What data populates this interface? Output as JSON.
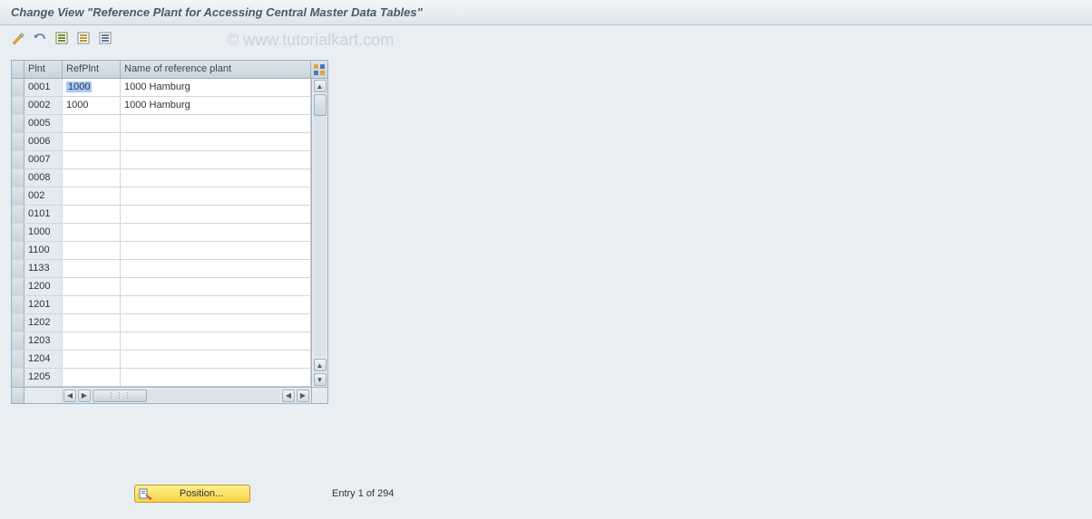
{
  "title": "Change View \"Reference Plant for Accessing Central Master Data Tables\"",
  "watermark": "© www.tutorialkart.com",
  "columns": {
    "plnt": "Plnt",
    "refplnt": "RefPlnt",
    "name": "Name of reference plant"
  },
  "rows": [
    {
      "plnt": "0001",
      "refplnt": "1000",
      "name": "1000 Hamburg",
      "highlight": true
    },
    {
      "plnt": "0002",
      "refplnt": "1000",
      "name": "1000 Hamburg"
    },
    {
      "plnt": "0005",
      "refplnt": "",
      "name": ""
    },
    {
      "plnt": "0006",
      "refplnt": "",
      "name": ""
    },
    {
      "plnt": "0007",
      "refplnt": "",
      "name": ""
    },
    {
      "plnt": "0008",
      "refplnt": "",
      "name": ""
    },
    {
      "plnt": "002",
      "refplnt": "",
      "name": ""
    },
    {
      "plnt": "0101",
      "refplnt": "",
      "name": ""
    },
    {
      "plnt": "1000",
      "refplnt": "",
      "name": ""
    },
    {
      "plnt": "1100",
      "refplnt": "",
      "name": ""
    },
    {
      "plnt": "1133",
      "refplnt": "",
      "name": ""
    },
    {
      "plnt": "1200",
      "refplnt": "",
      "name": ""
    },
    {
      "plnt": "1201",
      "refplnt": "",
      "name": ""
    },
    {
      "plnt": "1202",
      "refplnt": "",
      "name": ""
    },
    {
      "plnt": "1203",
      "refplnt": "",
      "name": ""
    },
    {
      "plnt": "1204",
      "refplnt": "",
      "name": ""
    },
    {
      "plnt": "1205",
      "refplnt": "",
      "name": ""
    }
  ],
  "position_button": "Position...",
  "entry_status": "Entry 1 of 294"
}
